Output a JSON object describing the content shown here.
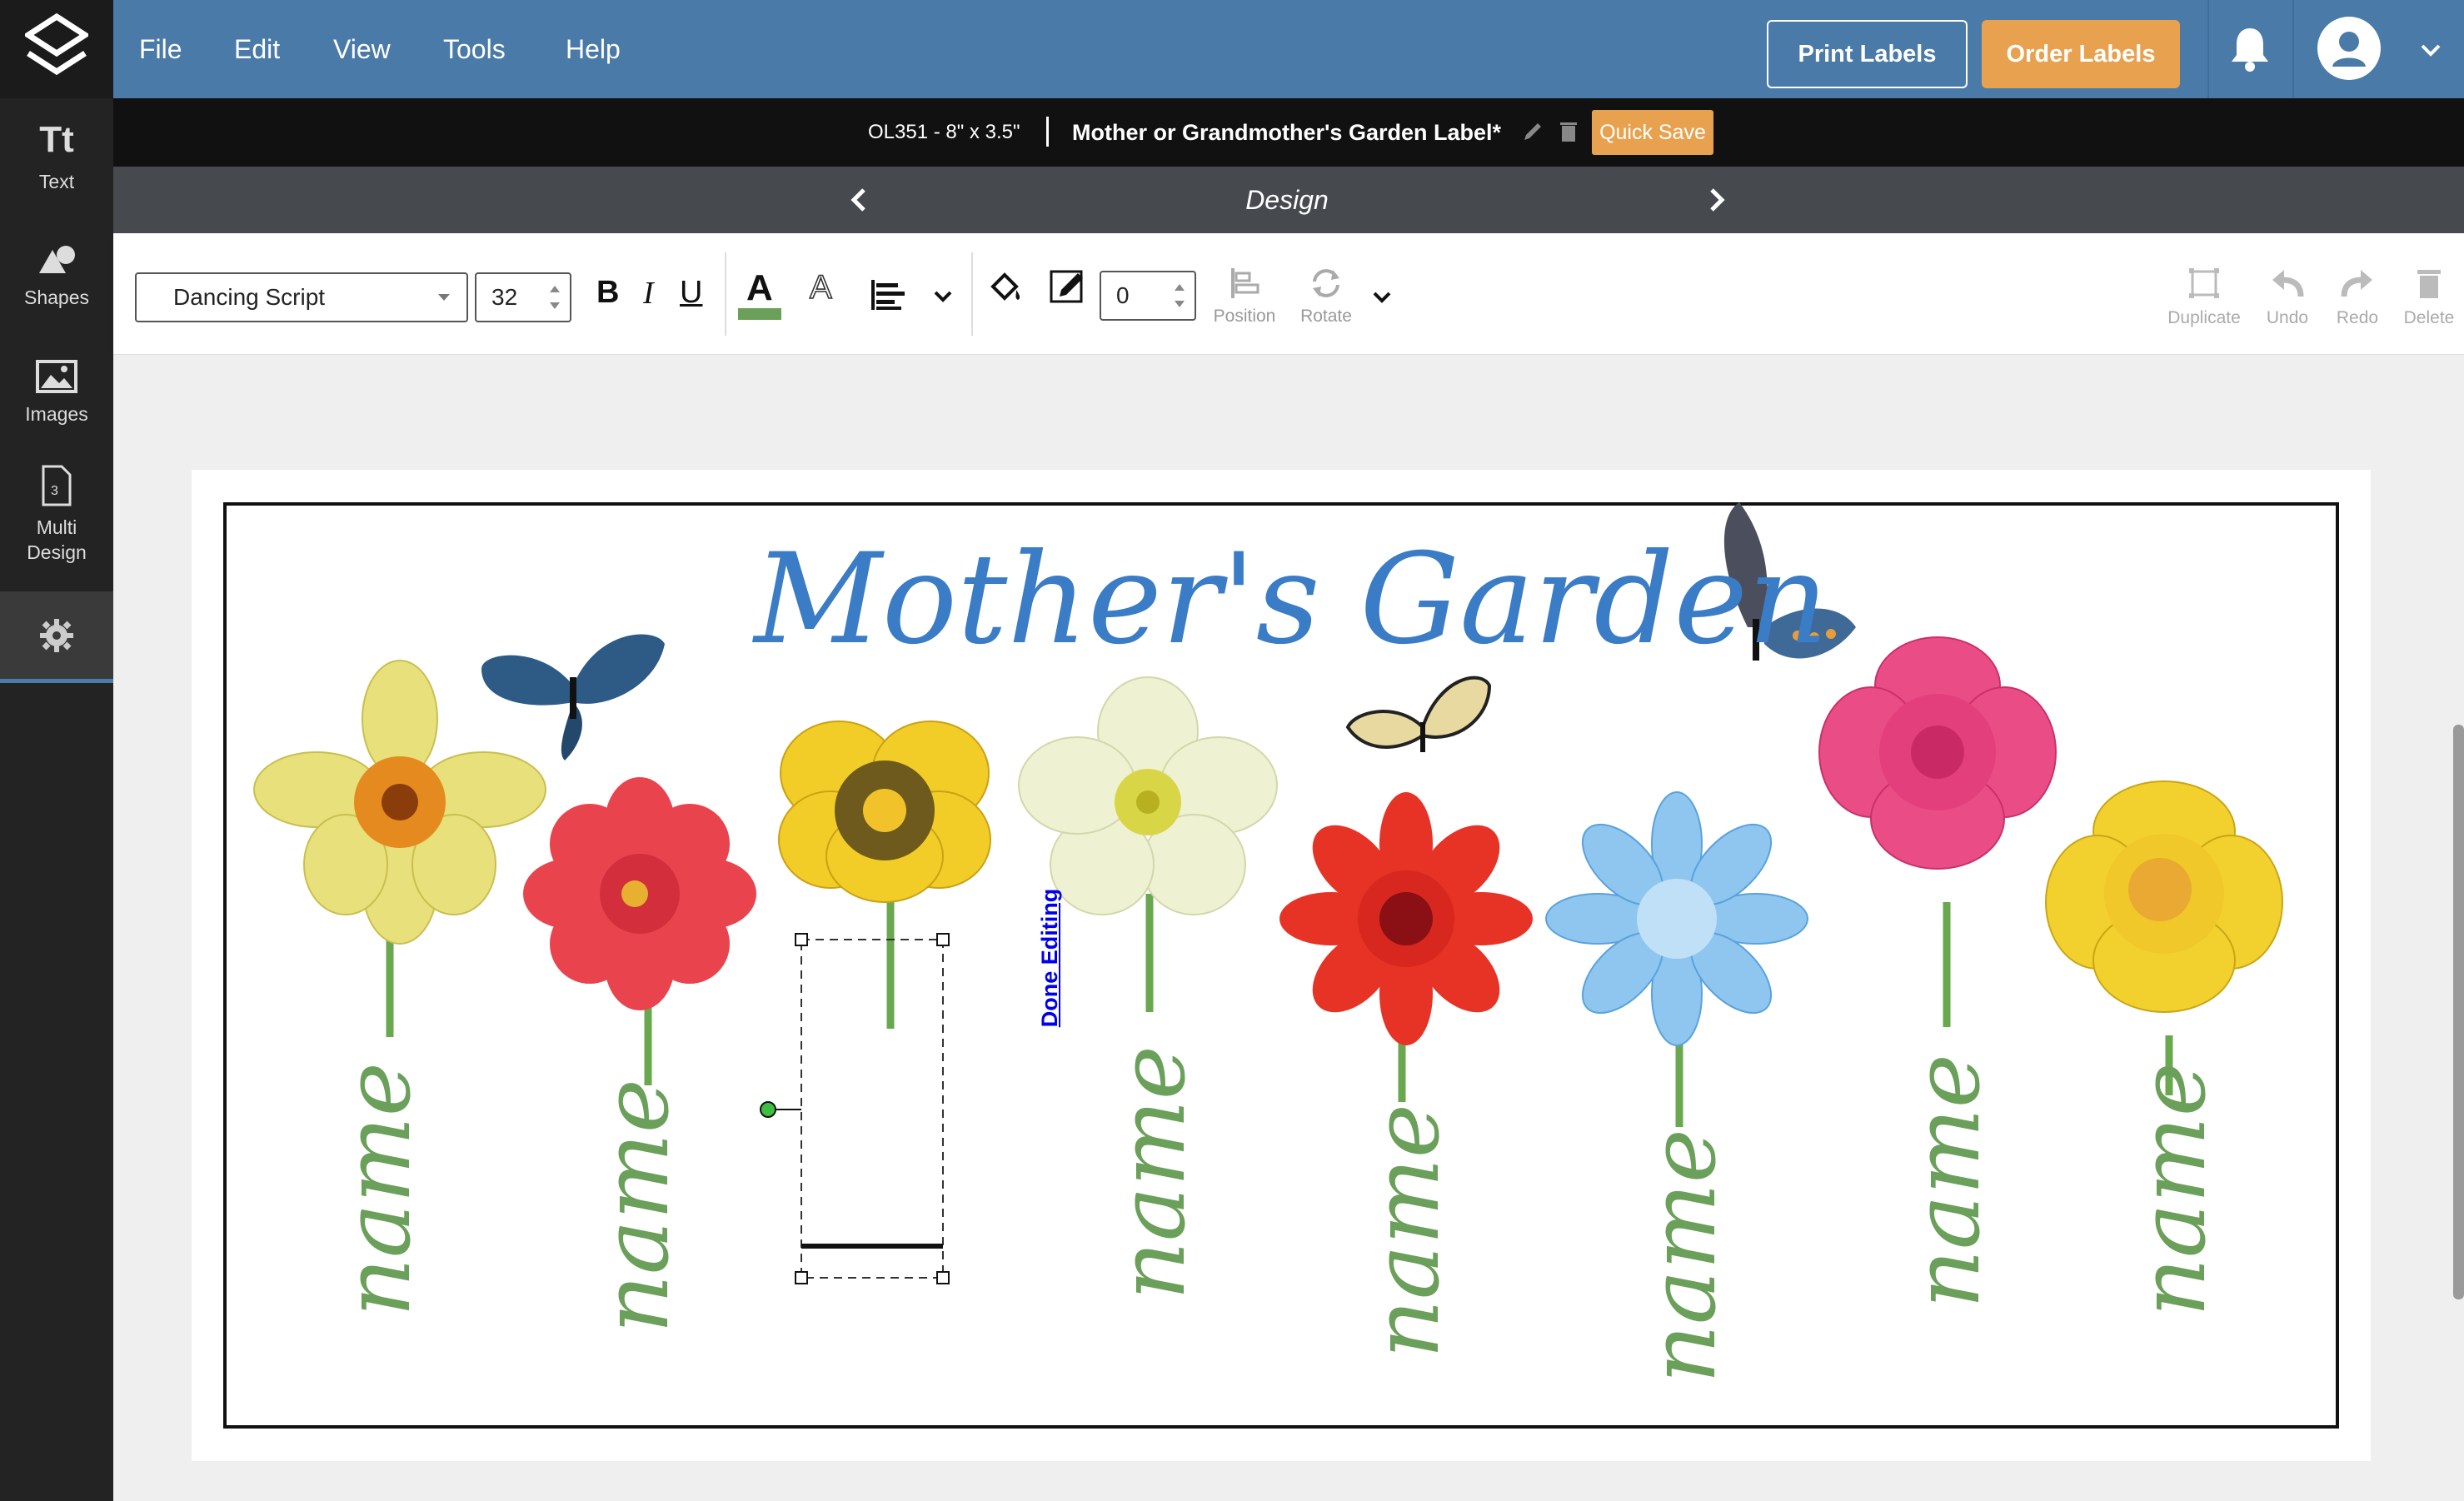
{
  "app": {
    "menu": [
      "File",
      "Edit",
      "View",
      "Tools",
      "Help"
    ],
    "print_label": "Print Labels",
    "order_label": "Order Labels"
  },
  "sidebar": {
    "items": [
      {
        "label": "Text",
        "icon": "text-icon"
      },
      {
        "label": "Shapes",
        "icon": "shapes-icon"
      },
      {
        "label": "Images",
        "icon": "images-icon"
      },
      {
        "label": "Multi Design",
        "icon": "multi-design-icon"
      },
      {
        "label": "",
        "icon": "gear-icon"
      }
    ]
  },
  "document": {
    "size": "OL351 - 8\" x 3.5\"",
    "name": "Mother or Grandmother's Garden Label*",
    "quick_save": "Quick Save"
  },
  "designbar": {
    "label": "Design"
  },
  "toolbar": {
    "font": "Dancing Script",
    "font_size": "32",
    "bold": "B",
    "italic": "I",
    "underline": "U",
    "stroke_width": "0",
    "position": "Position",
    "rotate": "Rotate",
    "duplicate": "Duplicate",
    "undo": "Undo",
    "redo": "Redo",
    "delete": "Delete",
    "text_color": "#6aa05a"
  },
  "label": {
    "title": "Mother's Garden",
    "names": [
      "name",
      "name",
      "name",
      "name",
      "name",
      "name",
      "name"
    ],
    "done_editing": "Done Editing"
  },
  "colors": {
    "topbar": "#4a7aa7",
    "accent_orange": "#e8a24f",
    "title_blue": "#3a7cc6",
    "name_green": "#6aa05a"
  }
}
